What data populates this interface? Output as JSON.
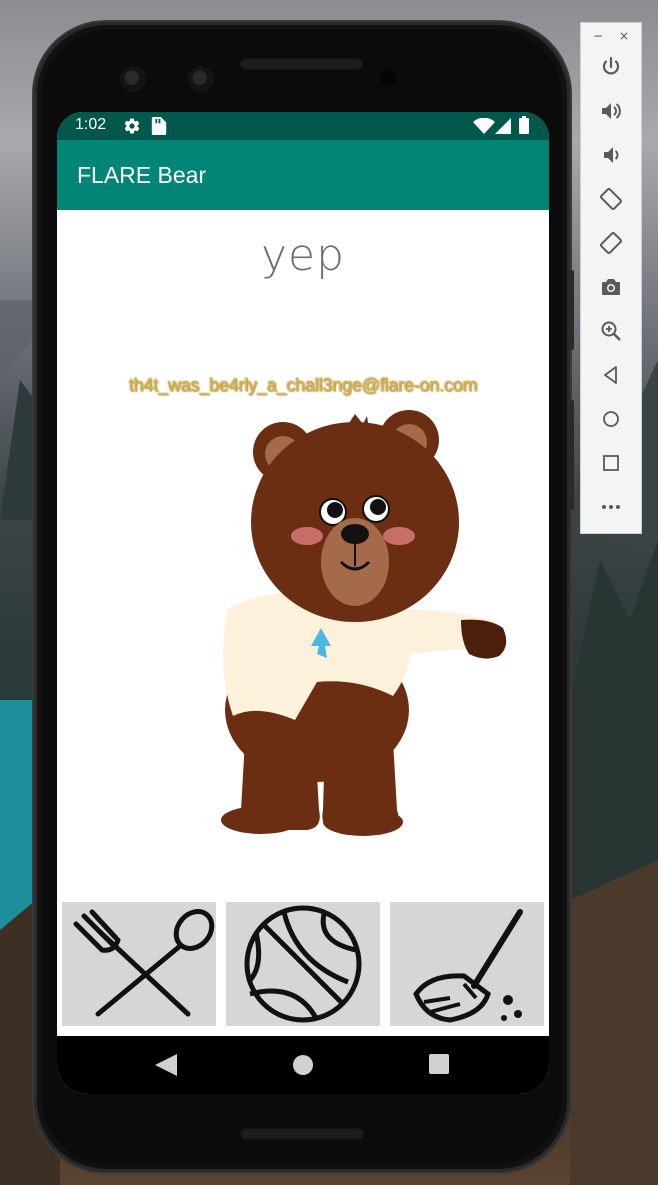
{
  "status_bar": {
    "time": "1:02"
  },
  "app_bar": {
    "title": "FLARE Bear"
  },
  "content": {
    "reaction_text": "yep",
    "flag_text": "th4t_was_be4rly_a_chall3nge@flare-on.com"
  },
  "action_buttons": [
    {
      "icon": "fork-spoon-icon",
      "action": "feed"
    },
    {
      "icon": "basketball-icon",
      "action": "play"
    },
    {
      "icon": "broom-icon",
      "action": "clean"
    }
  ],
  "emulator_toolbar": {
    "window_controls": {
      "minimize": "−",
      "close": "×"
    },
    "items": [
      "power-icon",
      "volume-up-icon",
      "volume-down-icon",
      "rotate-left-icon",
      "rotate-right-icon",
      "camera-icon",
      "zoom-icon",
      "back-icon",
      "home-icon",
      "overview-icon",
      "more-icon"
    ]
  },
  "colors": {
    "status_bar": "#00574B",
    "app_bar": "#008577",
    "button_bg": "#D6D6D6",
    "flag_text": "#D4B24A"
  }
}
